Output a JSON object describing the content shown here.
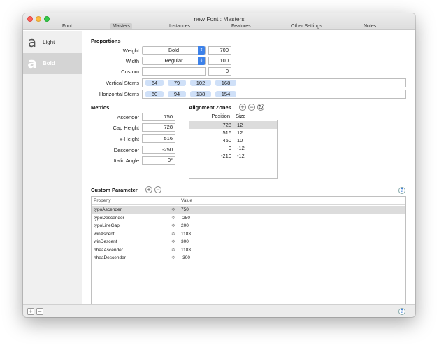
{
  "window": {
    "title": "new Font : Masters"
  },
  "tabs": [
    {
      "label": "Font",
      "active": false
    },
    {
      "label": "Masters",
      "active": true
    },
    {
      "label": "Instances",
      "active": false
    },
    {
      "label": "Features",
      "active": false
    },
    {
      "label": "Other Settings",
      "active": false
    },
    {
      "label": "Notes",
      "active": false
    }
  ],
  "sidebar": {
    "masters": [
      {
        "glyph": "a",
        "name": "Light",
        "selected": false
      },
      {
        "glyph": "a",
        "name": "Bold",
        "selected": true
      }
    ],
    "add_label": "+",
    "remove_label": "−"
  },
  "proportions": {
    "heading": "Proportions",
    "weight": {
      "label": "Weight",
      "selected": "Bold",
      "value": "700"
    },
    "width": {
      "label": "Width",
      "selected": "Regular",
      "value": "100"
    },
    "custom": {
      "label": "Custom",
      "name": "",
      "value": "0"
    },
    "vertical_stems": {
      "label": "Vertical Stems",
      "values": [
        "64",
        "79",
        "102",
        "168"
      ]
    },
    "horizontal_stems": {
      "label": "Horizontal Stems",
      "values": [
        "60",
        "94",
        "138",
        "154"
      ]
    }
  },
  "metrics": {
    "heading": "Metrics",
    "ascender": {
      "label": "Ascender",
      "value": "750"
    },
    "cap_height": {
      "label": "Cap Height",
      "value": "728"
    },
    "x_height": {
      "label": "x-Height",
      "value": "516"
    },
    "descender": {
      "label": "Descender",
      "value": "-250"
    },
    "italic_angle": {
      "label": "Italic Angle",
      "value": "0°"
    }
  },
  "alignment_zones": {
    "heading": "Alignment Zones",
    "add_label": "+",
    "remove_label": "−",
    "refresh_label": "↻",
    "col_position": "Position",
    "col_size": "Size",
    "rows": [
      {
        "position": "728",
        "size": "12"
      },
      {
        "position": "516",
        "size": "12"
      },
      {
        "position": "450",
        "size": "10"
      },
      {
        "position": "0",
        "size": "-12"
      },
      {
        "position": "-210",
        "size": "-12"
      }
    ]
  },
  "custom_parameters": {
    "heading": "Custom Parameter",
    "add_label": "+",
    "remove_label": "−",
    "col_property": "Property",
    "col_value": "Value",
    "stepper_glyph": "≎",
    "rows": [
      {
        "property": "typoAscender",
        "value": "750"
      },
      {
        "property": "typoDescender",
        "value": "-250"
      },
      {
        "property": "typoLineGap",
        "value": "200"
      },
      {
        "property": "winAscent",
        "value": "1183"
      },
      {
        "property": "winDescent",
        "value": "300"
      },
      {
        "property": "hheaAscender",
        "value": "1183"
      },
      {
        "property": "hheaDescender",
        "value": "-300"
      }
    ]
  },
  "help_label": "?",
  "colors": {
    "accent": "#3d82ea",
    "token": "#cfe0f8",
    "selection": "#dcdcdc"
  }
}
